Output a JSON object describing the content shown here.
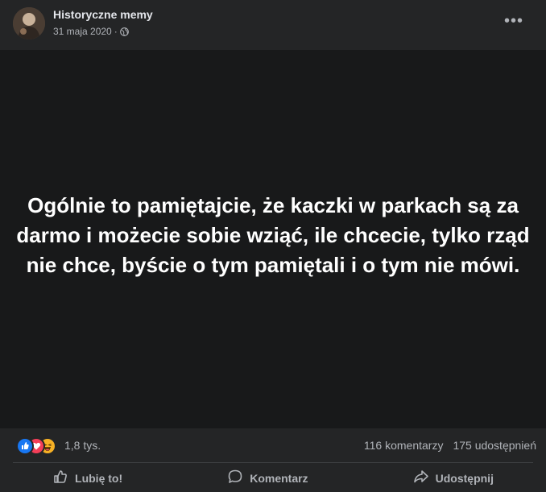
{
  "header": {
    "page_name": "Historyczne memy",
    "date": "31 maja 2020",
    "separator": "·",
    "privacy_icon": "globe-icon",
    "more_icon": "more-dots-icon",
    "more_label": "•••"
  },
  "post": {
    "text": "Ogólnie to pamiętajcie, że kaczki w parkach są za darmo i możecie sobie wziąć, ile chcecie, tylko rząd nie chce, byście o tym pamiętali i o tym nie mówi."
  },
  "reactions": {
    "icons": [
      "like-icon",
      "love-icon",
      "haha-icon"
    ],
    "count": "1,8 tys.",
    "comments": "116 komentarzy",
    "shares": "175 udostępnień"
  },
  "actions": {
    "like": "Lubię to!",
    "comment": "Komentarz",
    "share": "Udostępnij"
  },
  "colors": {
    "background": "#242526",
    "image_background": "#18191a",
    "like_blue": "#1877f2",
    "love_red": "#f33e58",
    "haha_yellow": "#f7b125"
  }
}
